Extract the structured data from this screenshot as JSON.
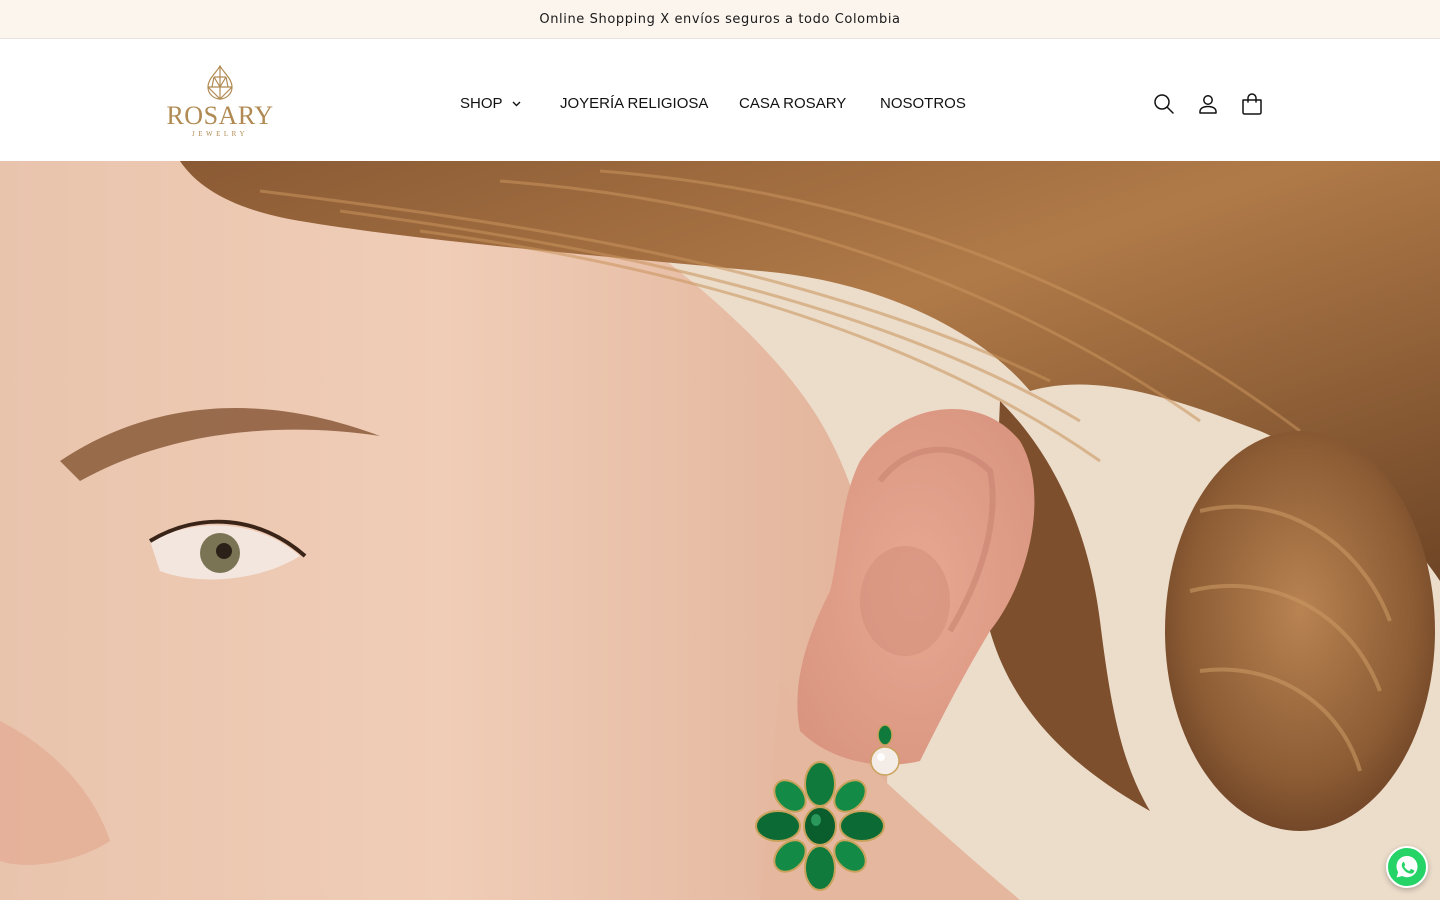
{
  "announcement": {
    "text": "Online Shopping X envíos seguros a todo Colombia"
  },
  "header": {
    "logo": {
      "name": "ROSARY",
      "tagline": "JEWELRY"
    },
    "nav": [
      {
        "label": "SHOP",
        "has_dropdown": true
      },
      {
        "label": "JOYERÍA RELIGIOSA"
      },
      {
        "label": "CASA ROSARY"
      },
      {
        "label": "NOSOTROS"
      }
    ],
    "icons": [
      "search-icon",
      "account-icon",
      "cart-icon"
    ]
  },
  "hero": {
    "image": "model-profile-emerald-flower-earring-and-pearl-stud"
  },
  "floating": {
    "icon": "whatsapp-icon"
  },
  "colors": {
    "announcement_bg": "#fbf5ee",
    "brand_gold": "#b08a52",
    "text": "#121212",
    "emerald": "#0f7a3c",
    "whatsapp": "#25d366"
  }
}
